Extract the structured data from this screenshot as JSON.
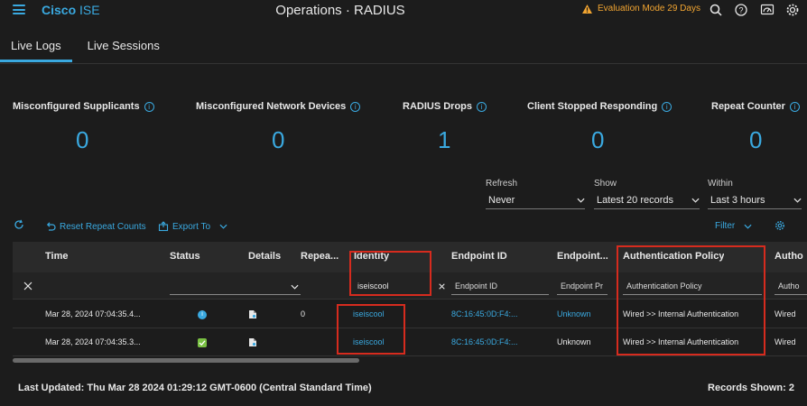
{
  "header": {
    "logo_brand": "Cisco",
    "logo_product": "ISE",
    "title": "Operations · RADIUS",
    "eval_mode": "Evaluation Mode 29 Days",
    "icons": [
      "menu-icon",
      "warning-icon",
      "search-icon",
      "help-icon",
      "dashboard-icon",
      "settings-icon"
    ]
  },
  "tabs": [
    {
      "label": "Live Logs",
      "active": true
    },
    {
      "label": "Live Sessions",
      "active": false
    }
  ],
  "counters": [
    {
      "label": "Misconfigured Supplicants",
      "value": "0"
    },
    {
      "label": "Misconfigured Network Devices",
      "value": "0"
    },
    {
      "label": "RADIUS Drops",
      "value": "1"
    },
    {
      "label": "Client Stopped Responding",
      "value": "0"
    },
    {
      "label": "Repeat Counter",
      "value": "0"
    }
  ],
  "filters": {
    "refresh": {
      "label": "Refresh",
      "value": "Never"
    },
    "show": {
      "label": "Show",
      "value": "Latest 20 records"
    },
    "within": {
      "label": "Within",
      "value": "Last 3 hours"
    }
  },
  "toolbar": {
    "reset": "Reset Repeat Counts",
    "export": "Export To",
    "filter": "Filter"
  },
  "table": {
    "columns": [
      "Time",
      "Status",
      "Details",
      "Repea...",
      "Identity",
      "Endpoint ID",
      "Endpoint...",
      "Authentication Policy",
      "Autho"
    ],
    "filters": {
      "identity": "iseiscool",
      "endpoint_id_placeholder": "Endpoint ID",
      "endpoint_profile_placeholder": "Endpoint Pr",
      "auth_policy_placeholder": "Authentication Policy",
      "authz_placeholder": "Autho"
    },
    "rows": [
      {
        "time": "Mar 28, 2024 07:04:35.4...",
        "status": "info",
        "repeat": "0",
        "identity": "iseiscool",
        "endpoint_id": "8C:16:45:0D:F4:...",
        "endpoint_profile": "Unknown",
        "auth_policy": "Wired >> Internal Authentication",
        "authz": "Wired"
      },
      {
        "time": "Mar 28, 2024 07:04:35.3...",
        "status": "pass",
        "repeat": "",
        "identity": "iseiscool",
        "endpoint_id": "8C:16:45:0D:F4:...",
        "endpoint_profile": "Unknown",
        "auth_policy": "Wired >> Internal Authentication",
        "authz": "Wired"
      }
    ]
  },
  "footer": {
    "last_updated": "Last Updated: Thu Mar 28 2024 01:29:12 GMT-0600 (Central Standard Time)",
    "records_shown": "Records Shown: 2"
  },
  "colors": {
    "background": "#1c1c1c",
    "accent": "#3aa9e0",
    "warning": "#f2a531",
    "highlight": "#d62b1e",
    "success": "#7ac143"
  }
}
